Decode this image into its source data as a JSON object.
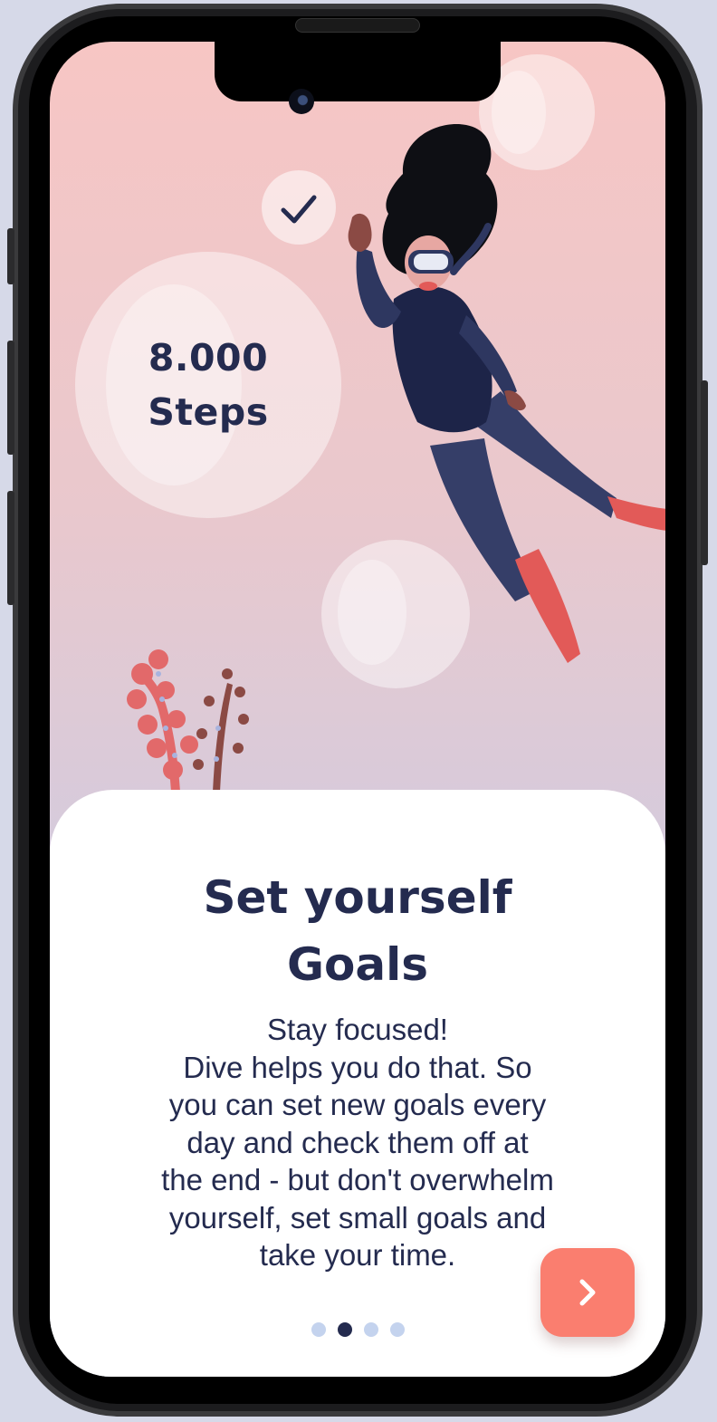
{
  "goal_bubble": {
    "value": "8.000",
    "unit": "Steps"
  },
  "onboarding": {
    "title_line1": "Set yourself",
    "title_line2": "Goals",
    "body_lines": [
      "Stay focused!",
      "Dive helps you do that. So",
      "you can set new goals every",
      "day and check them off at",
      "the end - but don't overwhelm",
      "yourself, set small goals and",
      "take your time."
    ],
    "pagination": {
      "total": 4,
      "current": 2
    },
    "next_icon": "chevron-right-icon"
  },
  "colors": {
    "navy": "#242b4f",
    "accent": "#fa7e6f",
    "dot_inactive": "#c4d3ee",
    "coral": "#e2696a"
  }
}
